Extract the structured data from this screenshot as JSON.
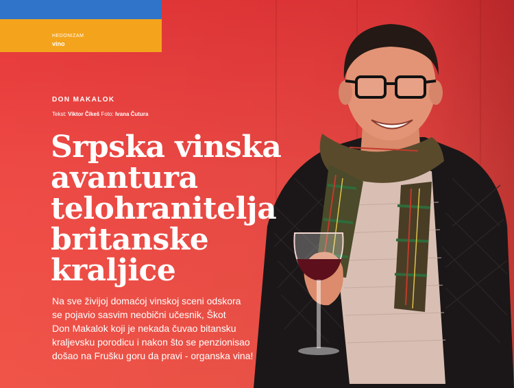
{
  "section": {
    "label": "HEDONIZAM",
    "sub": "vino"
  },
  "article": {
    "kicker": "DON MAKALOK",
    "credits": {
      "text_prefix": "Tekst:",
      "author": "Viktor Čikeš",
      "photo_prefix": "Foto:",
      "photographer": "Ivana Čutura"
    },
    "headline_lines": [
      "Srpska vinska",
      "avantura",
      "telohranitelja",
      "britanske",
      "kraljice"
    ],
    "lede_lines": [
      "Na sve živijoj domaćoj vinskoj sceni odskora",
      "se pojavio sasvim neobični učesnik, Škot",
      "Don Makalok koji je nekada čuvao bitansku",
      "kraljevsku porodicu i nakon što se penzionisao",
      "došao na Frušku goru da pravi - organska vina!"
    ]
  },
  "colors": {
    "background": "#e8383a",
    "tab_orange": "#f4a41c",
    "tab_blue": "#2f74c8",
    "text": "#ffffff"
  }
}
